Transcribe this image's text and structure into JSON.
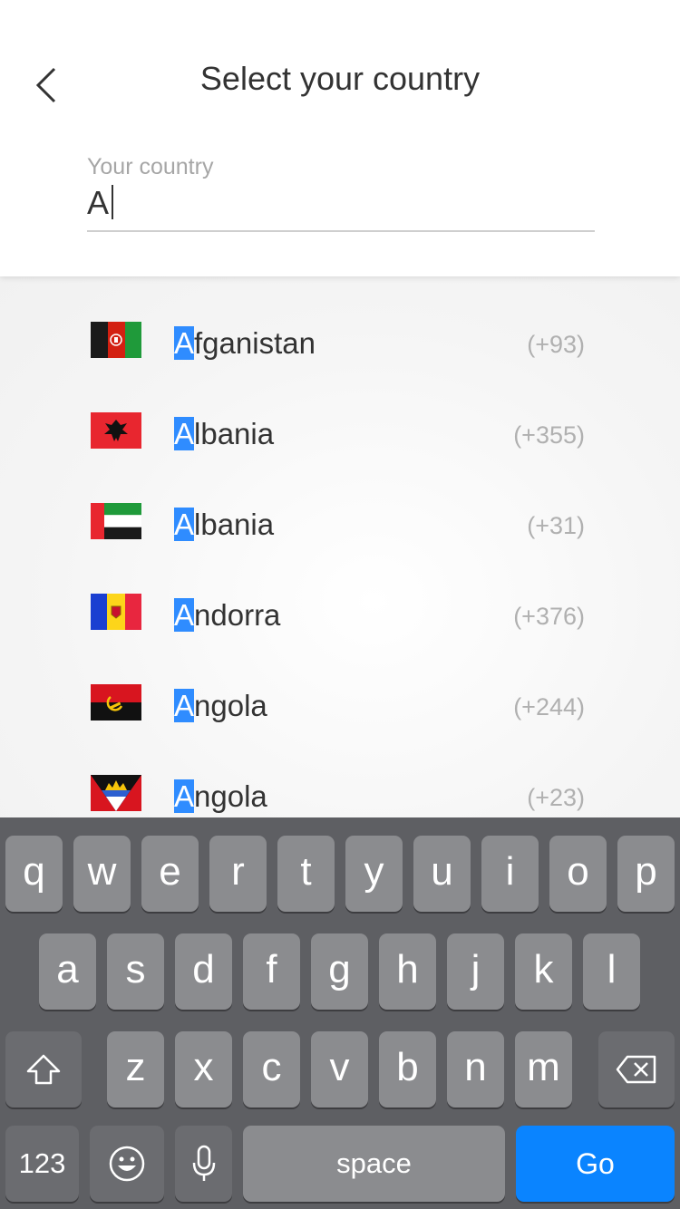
{
  "header": {
    "title": "Select your country",
    "back_icon": "chevron-left-icon"
  },
  "search": {
    "label": "Your country",
    "value": "A"
  },
  "countries": [
    {
      "first": "A",
      "rest": "fganistan",
      "code": "(+93)",
      "flag": "afghanistan-flag-icon"
    },
    {
      "first": "A",
      "rest": "lbania",
      "code": "(+355)",
      "flag": "albania-flag-icon"
    },
    {
      "first": "A",
      "rest": "lbania",
      "code": "(+31)",
      "flag": "uae-flag-icon"
    },
    {
      "first": "A",
      "rest": "ndorra",
      "code": "(+376)",
      "flag": "andorra-flag-icon"
    },
    {
      "first": "A",
      "rest": "ngola",
      "code": "(+244)",
      "flag": "angola-flag-icon"
    },
    {
      "first": "A",
      "rest": "ngola",
      "code": "(+23)",
      "flag": "antigua-flag-icon"
    }
  ],
  "keyboard": {
    "row1": [
      "q",
      "w",
      "e",
      "r",
      "t",
      "y",
      "u",
      "i",
      "o",
      "p"
    ],
    "row2": [
      "a",
      "s",
      "d",
      "f",
      "g",
      "h",
      "j",
      "k",
      "l"
    ],
    "row3": [
      "z",
      "x",
      "c",
      "v",
      "b",
      "n",
      "m"
    ],
    "numbers_label": "123",
    "space_label": "space",
    "go_label": "Go",
    "shift_icon": "shift-icon",
    "delete_icon": "backspace-icon",
    "emoji_icon": "emoji-icon",
    "mic_icon": "microphone-icon"
  },
  "colors": {
    "highlight": "#2f8cff",
    "go_key": "#0a84ff",
    "keyboard_bg": "#5e5f63"
  }
}
